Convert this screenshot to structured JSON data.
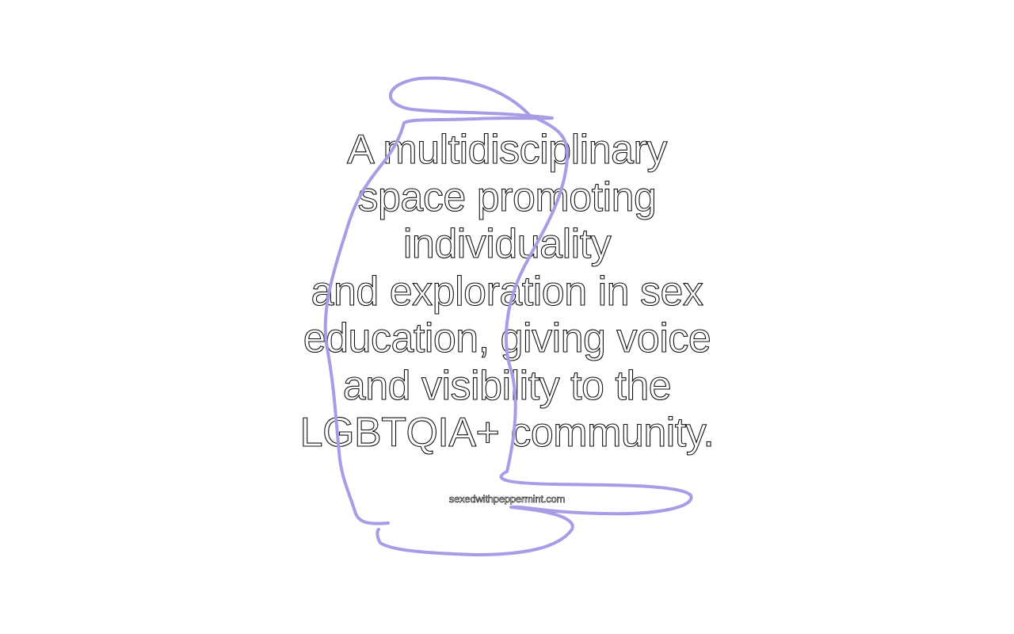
{
  "headline": {
    "lines": [
      "A multidisciplinary",
      "space promoting",
      "individuality",
      "and exploration in sex",
      "education, giving voice",
      "and visibility to the",
      "LGBTQIA+ community."
    ]
  },
  "footer": {
    "link_text": "sexedwithpeppermint.com"
  },
  "colors": {
    "scribble": "#a89ce6",
    "text_outline": "#111111",
    "background": "#ffffff"
  },
  "icons": {
    "decoration": "hand-drawn-scribble"
  }
}
